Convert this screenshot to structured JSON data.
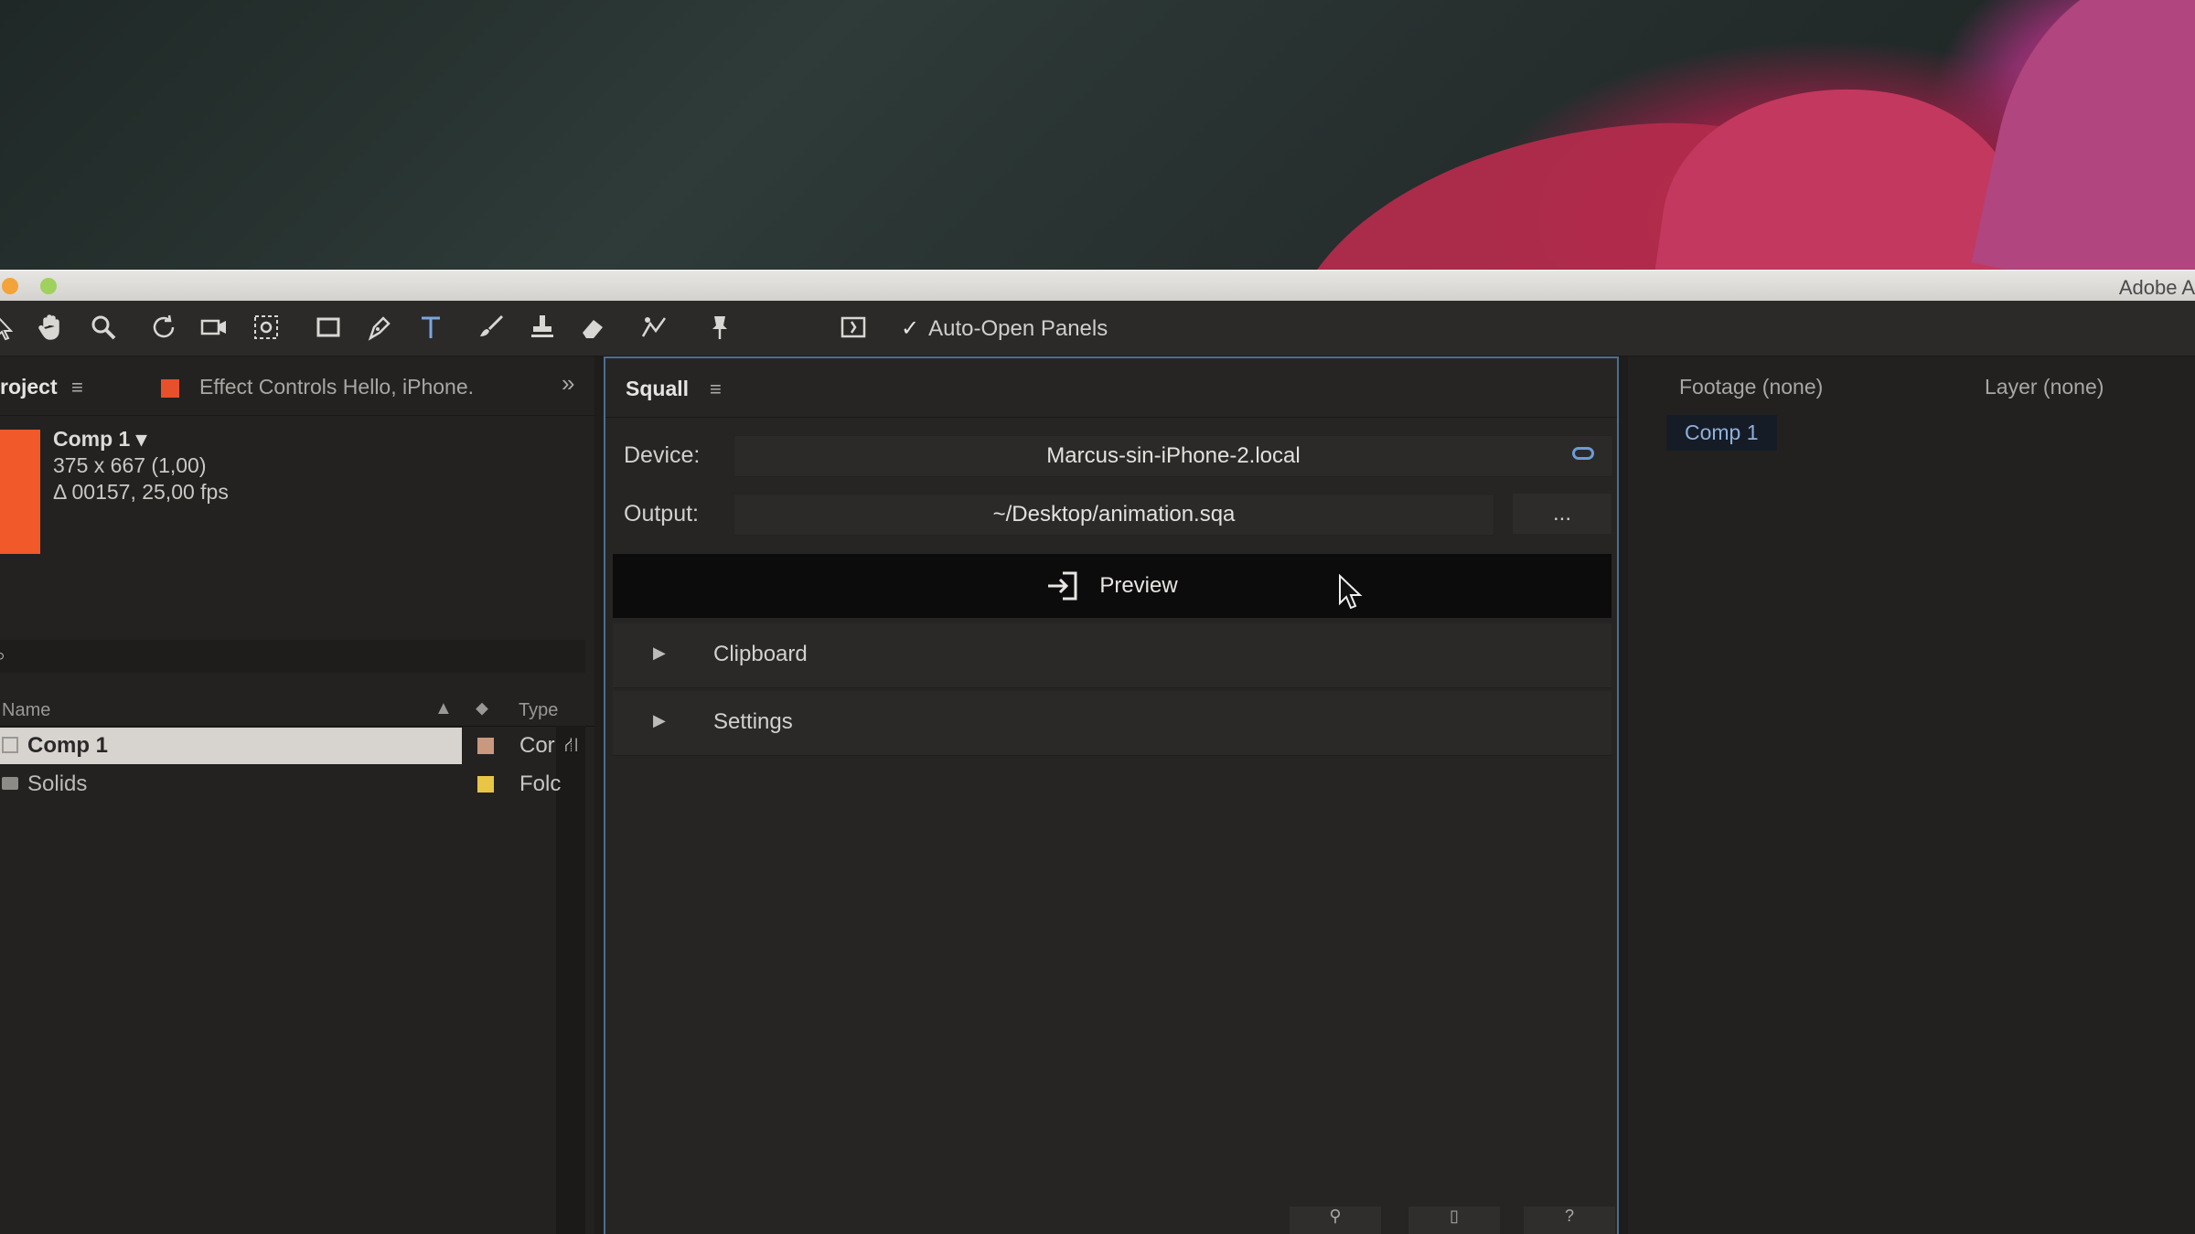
{
  "window": {
    "title": "Adobe A"
  },
  "toolbar": {
    "tools": [
      "selection-tool",
      "hand-tool",
      "zoom-tool",
      "rotate-tool",
      "camera-tool",
      "pan-behind-tool",
      "rectangle-tool",
      "pen-tool",
      "type-tool",
      "brush-tool",
      "clone-stamp-tool",
      "eraser-tool",
      "roto-brush-tool",
      "puppet-pin-tool"
    ],
    "auto_open_label": "Auto-Open Panels",
    "auto_open_checked": "✓"
  },
  "project_panel": {
    "tab_label": "roject",
    "effect_controls_tab": "Effect Controls Hello, iPhone.",
    "overflow": "»",
    "comp": {
      "name": "Comp 1 ▾",
      "size": "375 x 667 (1,00)",
      "duration": "Δ 00157, 25,00 fps"
    },
    "columns": {
      "name": "Name",
      "type": "Type"
    },
    "items": [
      {
        "name": "Comp 1",
        "type": "Cor",
        "chip_color": "#c9987e",
        "selected": true
      },
      {
        "name": "Solids",
        "type": "Folc",
        "chip_color": "#e8c545",
        "selected": false
      }
    ]
  },
  "squall_panel": {
    "title": "Squall",
    "menu": "≡",
    "device_label": "Device:",
    "device_value": "Marcus-sin-iPhone-2.local",
    "output_label": "Output:",
    "output_value": "~/Desktop/animation.sqa",
    "browse": "...",
    "preview_label": "Preview",
    "sections": [
      "Clipboard",
      "Settings"
    ]
  },
  "viewer_panel": {
    "footage_tab": "Footage (none)",
    "layer_tab": "Layer (none)",
    "comp_tab": "Comp 1"
  },
  "colors": {
    "accent_blue": "#4d6e8e",
    "comp_swatch": "#f1582a"
  }
}
